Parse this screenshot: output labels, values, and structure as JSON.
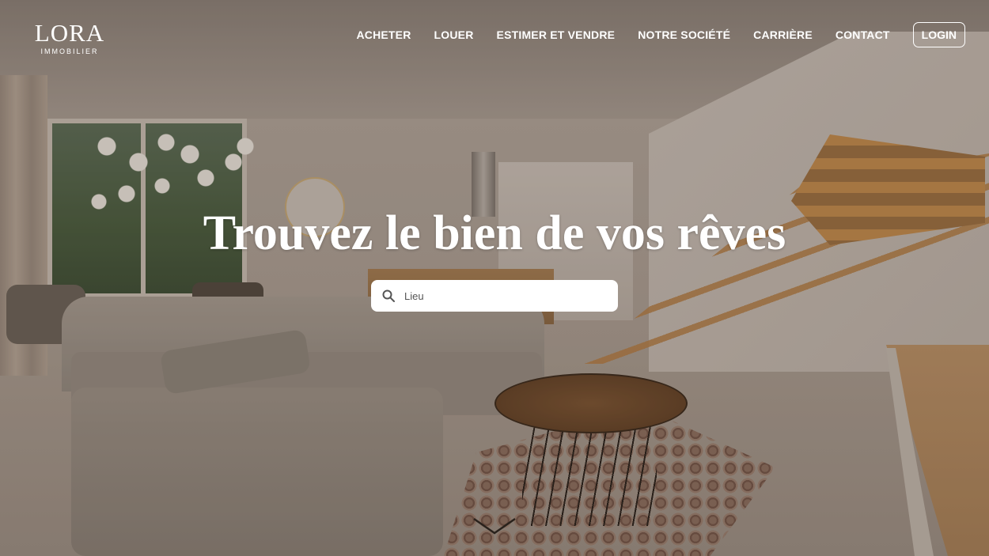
{
  "logo": {
    "word": "LORA",
    "subtitle": "IMMOBILIER"
  },
  "nav": {
    "items": [
      {
        "label": "ACHETER"
      },
      {
        "label": "LOUER"
      },
      {
        "label": "ESTIMER ET VENDRE"
      },
      {
        "label": "NOTRE SOCIÉTÉ"
      },
      {
        "label": "CARRIÈRE"
      },
      {
        "label": "CONTACT"
      }
    ],
    "login_label": "LOGIN"
  },
  "hero": {
    "title": "Trouvez le bien de vos rêves",
    "search": {
      "placeholder": "Lieu",
      "value": "",
      "icon": "search-icon"
    },
    "scroll_icon": "chevron-down-icon"
  },
  "colors": {
    "text": "#ffffff",
    "search_bg": "#ffffff"
  }
}
